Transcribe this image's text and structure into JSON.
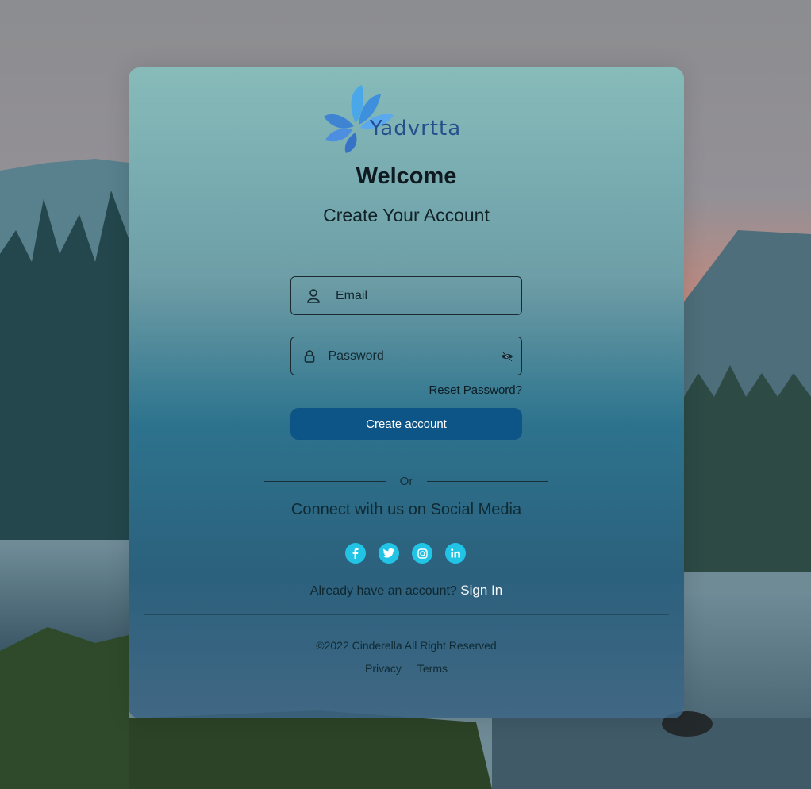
{
  "brand": {
    "name": "Yadvrtta",
    "color": "#244e8c",
    "icon": "lotus-logo"
  },
  "header": {
    "welcome": "Welcome",
    "subtitle": "Create Your Account"
  },
  "form": {
    "email_placeholder": "Email",
    "password_placeholder": "Password",
    "email_icon": "user-icon",
    "password_icon": "lock-icon",
    "visibility_icon": "eye-slash-icon",
    "reset_label": "Reset Password?",
    "create_label": "Create account",
    "create_color": "#0d5587"
  },
  "divider": {
    "or_label": "Or"
  },
  "social": {
    "heading": "Connect with us on Social Media",
    "color": "#22c4e6",
    "items": [
      {
        "name": "facebook",
        "icon": "facebook-icon"
      },
      {
        "name": "twitter",
        "icon": "twitter-icon"
      },
      {
        "name": "instagram",
        "icon": "instagram-icon"
      },
      {
        "name": "linkedin",
        "icon": "linkedin-icon"
      }
    ]
  },
  "signin": {
    "prompt": "Already have an account?",
    "link": "Sign In"
  },
  "footer": {
    "copyright": "©2022 Cinderella All Right Reserved",
    "privacy": "Privacy",
    "terms": "Terms"
  }
}
